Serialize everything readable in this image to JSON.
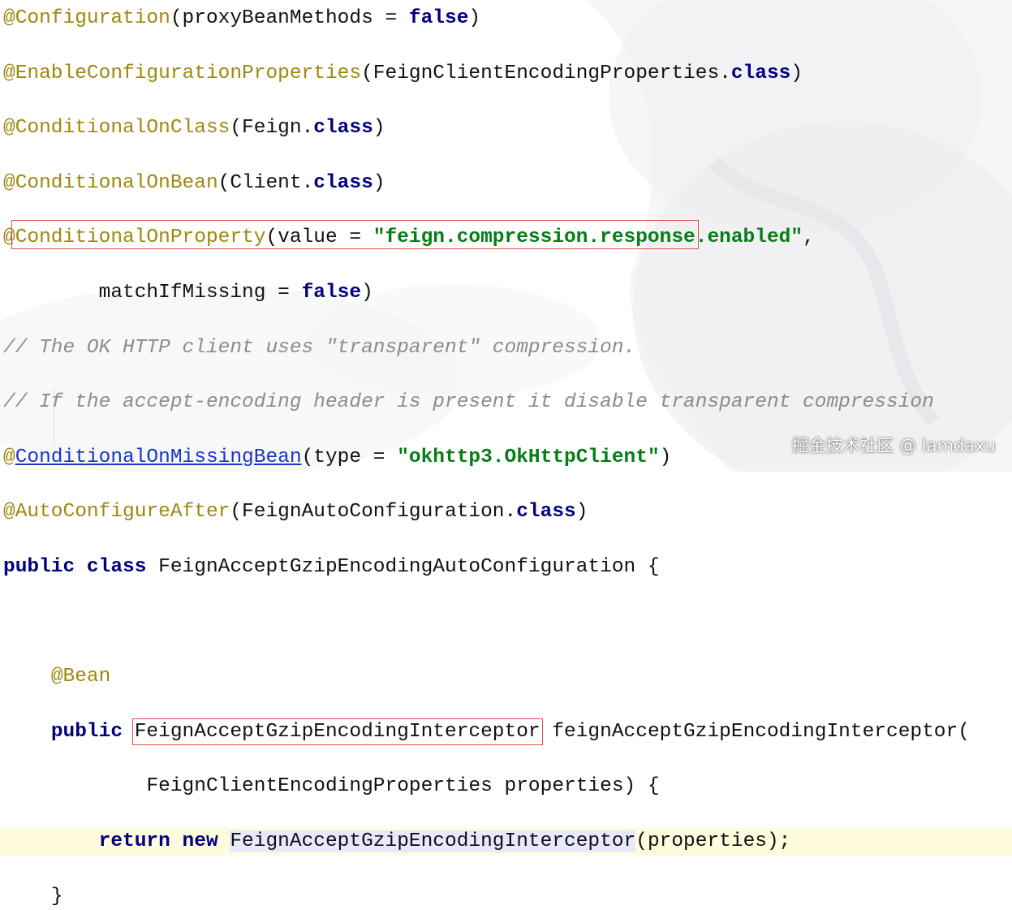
{
  "colors": {
    "annotation": "#9e880d",
    "keyword": "#000080",
    "string": "#067d17",
    "comment": "#8c8c8c",
    "highlight_box": "#d9534f"
  },
  "code": {
    "l1": {
      "ann": "@Configuration",
      "a": "(proxyBeanMethods = ",
      "kw": "false",
      "b": ")"
    },
    "l2": {
      "ann": "@EnableConfigurationProperties",
      "a": "(FeignClientEncodingProperties.",
      "kw": "class",
      "b": ")"
    },
    "l3": {
      "ann": "@ConditionalOnClass",
      "a": "(Feign.",
      "kw": "class",
      "b": ")"
    },
    "l4": {
      "ann": "@ConditionalOnBean",
      "a": "(Client.",
      "kw": "class",
      "b": ")"
    },
    "l5": {
      "ann": "@ConditionalOnProperty",
      "a": "(value = ",
      "str": "\"feign.compression.response.enabled\"",
      "b": ","
    },
    "l6": {
      "indent": "        ",
      "a": "matchIfMissing = ",
      "kw": "false",
      "b": ")"
    },
    "l7": {
      "cmt": "// The OK HTTP client uses \"transparent\" compression."
    },
    "l8": {
      "cmt": "// If the accept-encoding header is present it disable transparent compression"
    },
    "l9": {
      "at": "@",
      "link": "ConditionalOnMissingBean",
      "a": "(type = ",
      "str": "\"okhttp3.OkHttpClient\"",
      "b": ")"
    },
    "l10": {
      "ann": "@AutoConfigureAfter",
      "a": "(FeignAutoConfiguration.",
      "kw": "class",
      "b": ")"
    },
    "l11": {
      "kw1": "public",
      "kw2": "class",
      "a": " FeignAcceptGzipEncodingAutoConfiguration {"
    },
    "l13": {
      "indent": "    ",
      "ann": "@Bean"
    },
    "l14": {
      "indent": "    ",
      "kw": "public",
      "type": "FeignAcceptGzipEncodingInterceptor",
      "a": " feignAcceptGzipEncodingInterceptor("
    },
    "l15": {
      "indent": "            ",
      "a": "FeignClientEncodingProperties properties) {"
    },
    "l16": {
      "indent": "        ",
      "kw1": "return",
      "kw2": "new",
      "type": "FeignAcceptGzipEncodingInterceptor",
      "a": "(properties);"
    },
    "l17": {
      "indent": "    ",
      "a": "}"
    }
  },
  "watermark": "掘金技术社区 @ lamdaxu"
}
